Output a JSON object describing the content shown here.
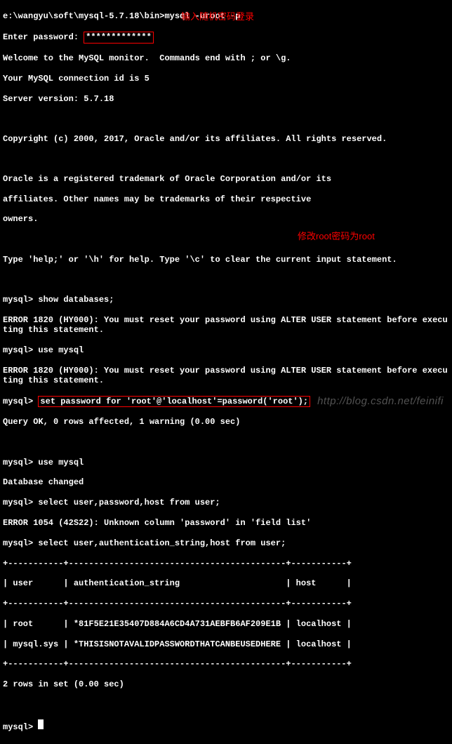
{
  "lines": {
    "l0": "e:\\wangyu\\soft\\mysql-5.7.18\\bin>mysql -uroot -p",
    "l1a": "Enter password: ",
    "l1b": "*************",
    "l2": "Welcome to the MySQL monitor.  Commands end with ; or \\g.",
    "l3": "Your MySQL connection id is 5",
    "l4": "Server version: 5.7.18",
    "l5": "",
    "l6": "Copyright (c) 2000, 2017, Oracle and/or its affiliates. All rights reserved.",
    "l7": "",
    "l8": "Oracle is a registered trademark of Oracle Corporation and/or its",
    "l9": "affiliates. Other names may be trademarks of their respective",
    "l10": "owners.",
    "l11": "",
    "l12": "Type 'help;' or '\\h' for help. Type '\\c' to clear the current input statement.",
    "l13": "",
    "l14": "mysql> show databases;",
    "l15": "ERROR 1820 (HY000): You must reset your password using ALTER USER statement before executing this statement.",
    "l16": "mysql> use mysql",
    "l17": "ERROR 1820 (HY000): You must reset your password using ALTER USER statement before executing this statement.",
    "l18a": "mysql> ",
    "l18b": "set password for 'root'@'localhost'=password('root');",
    "l19": "Query OK, 0 rows affected, 1 warning (0.00 sec)",
    "l20": "",
    "l21": "mysql> use mysql",
    "l22": "Database changed",
    "l23": "mysql> select user,password,host from user;",
    "l24": "ERROR 1054 (42S22): Unknown column 'password' in 'field list'",
    "l25": "mysql> select user,authentication_string,host from user;",
    "l26": "+-----------+-------------------------------------------+-----------+",
    "l27": "| user      | authentication_string                     | host      |",
    "l28": "+-----------+-------------------------------------------+-----------+",
    "l29": "| root      | *81F5E21E35407D884A6CD4A731AEBFB6AF209E1B | localhost |",
    "l30": "| mysql.sys | *THISISNOTAVALIDPASSWORDTHATCANBEUSEDHERE | localhost |",
    "l31": "+-----------+-------------------------------------------+-----------+",
    "l32": "2 rows in set (0.00 sec)",
    "l33": "",
    "l34": "mysql> "
  },
  "annotations": {
    "a1": "输入随机密码登录",
    "a2": "修改root密码为root"
  },
  "watermark": "http://blog.csdn.net/feinifi"
}
